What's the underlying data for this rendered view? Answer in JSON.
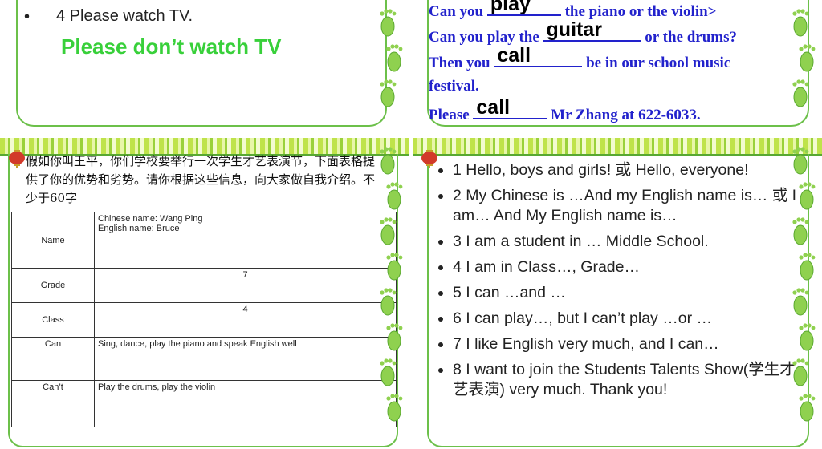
{
  "slide1": {
    "bullet": "•",
    "line1": "4 Please watch TV.",
    "line2": "Please don’t watch TV"
  },
  "slide2": {
    "rows": [
      {
        "before": "Can you ",
        "fill": "play",
        "after": " the piano or the violin>"
      },
      {
        "before": "Can you play the ",
        "fill": "guitar",
        "after": " or the drums?"
      },
      {
        "before": "Then you ",
        "fill": "call",
        "after": " be in our school music"
      },
      {
        "before": "festival.",
        "fill": "",
        "after": ""
      },
      {
        "before": "Please ",
        "fill": "call",
        "after": " Mr Zhang at 622-6033."
      }
    ]
  },
  "slide3": {
    "paragraph": "假如你叫王平，你们学校要举行一次学生才艺表演节，下面表格提供了你的优势和劣势。请你根据这些信息，向大家做自我介绍。不少于60字",
    "table": [
      {
        "label": "Name",
        "line1": "Chinese name:   Wang Ping",
        "line2": "English name:        Bruce",
        "centered": false
      },
      {
        "label": "Grade",
        "line1": "7",
        "line2": "",
        "centered": true
      },
      {
        "label": "Class",
        "line1": "4",
        "line2": "",
        "centered": true
      },
      {
        "label": "Can",
        "line1": "Sing, dance, play the piano and speak English well",
        "line2": "",
        "centered": false
      },
      {
        "label": "Can’t",
        "line1": "Play the drums, play the violin",
        "line2": "",
        "centered": false
      }
    ]
  },
  "slide4": {
    "items": [
      "1 Hello, boys and girls! 或 Hello, everyone!",
      "2 My Chinese is …And my English name is… 或 I am… And My English name is…",
      "3 I am a student in … Middle School.",
      "4 I am in Class…, Grade…",
      "5 I can …and …",
      "6 I can play…, but I can’t play …or …",
      "7 I like English very much, and I can…",
      "8 I want to join the Students Talents Show(学生才艺表演) very much. Thank you!"
    ]
  },
  "colors": {
    "accent_green": "#38d03a",
    "frame_green": "#6cc04a",
    "text_blue": "#2222cc"
  }
}
